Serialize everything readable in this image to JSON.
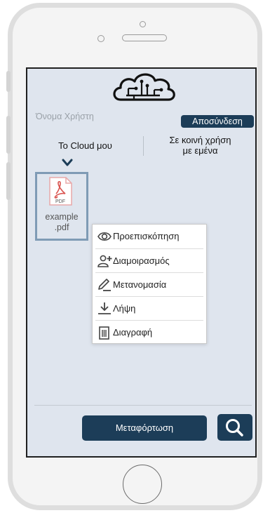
{
  "header": {
    "username": "Όνομα Χρήστη",
    "logout_label": "Αποσύνδεση"
  },
  "tabs": [
    {
      "label": "Το Cloud μου"
    },
    {
      "label": "Σε κοινή χρήση\nμε εμένα"
    }
  ],
  "file": {
    "type_label": "PDF",
    "name": "example\n.pdf"
  },
  "context_menu": [
    {
      "label": "Προεπισκόπηση",
      "icon": "eye-icon"
    },
    {
      "label": "Διαμοιρασμός",
      "icon": "add-user-icon"
    },
    {
      "label": "Μετανομασία",
      "icon": "pencil-icon"
    },
    {
      "label": "Λήψη",
      "icon": "download-icon"
    },
    {
      "label": "Διαγραφή",
      "icon": "trash-icon"
    }
  ],
  "footer": {
    "upload_label": "Μεταφόρτωση",
    "search_icon": "search-icon"
  },
  "colors": {
    "primary": "#1c3d58",
    "screen_bg": "#dfe5ee",
    "file_border": "#7f9bb5",
    "pdf_red": "#d9534f"
  }
}
